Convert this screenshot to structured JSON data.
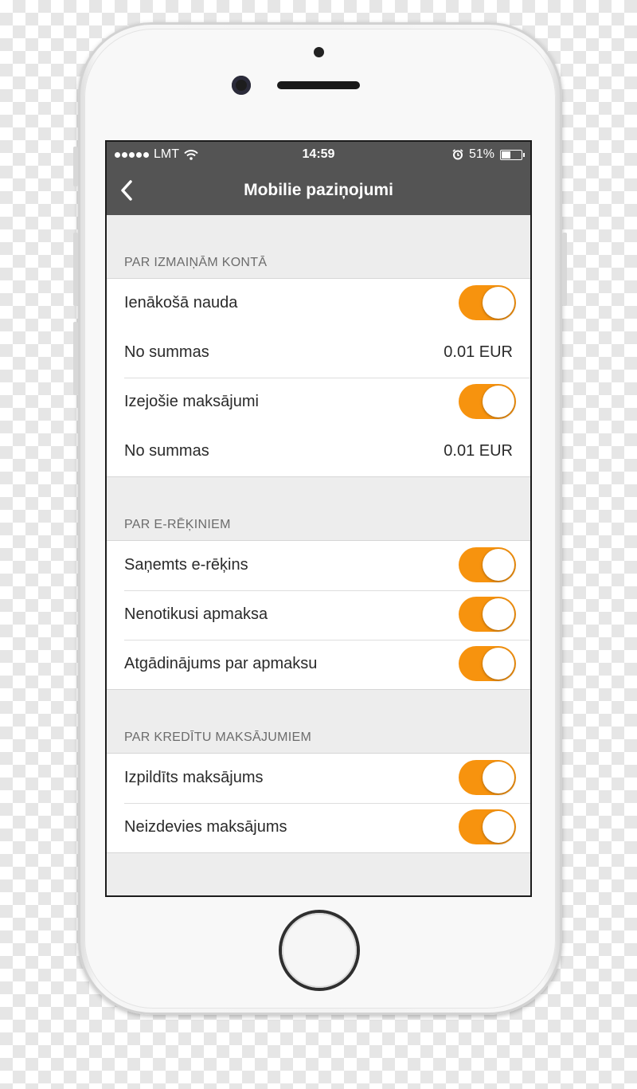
{
  "status_bar": {
    "carrier": "LMT",
    "time": "14:59",
    "battery_percent": "51%",
    "battery_level": 0.51
  },
  "nav": {
    "title": "Mobilie paziņojumi"
  },
  "sections": [
    {
      "header": "PAR IZMAIŅĀM KONTĀ",
      "rows": [
        {
          "label": "Ienākošā nauda",
          "toggle_on": true
        },
        {
          "label": "No summas",
          "value": "0.01  EUR"
        },
        {
          "label": "Izejošie maksājumi",
          "toggle_on": true
        },
        {
          "label": "No summas",
          "value": "0.01  EUR"
        }
      ]
    },
    {
      "header": "PAR E-RĒĶINIEM",
      "rows": [
        {
          "label": "Saņemts e-rēķins",
          "toggle_on": true
        },
        {
          "label": "Nenotikusi apmaksa",
          "toggle_on": true
        },
        {
          "label": "Atgādinājums par apmaksu",
          "toggle_on": true
        }
      ]
    },
    {
      "header": "PAR KREDĪTU MAKSĀJUMIEM",
      "rows": [
        {
          "label": "Izpildīts maksājums",
          "toggle_on": true
        },
        {
          "label": "Neizdevies maksājums",
          "toggle_on": true
        }
      ]
    }
  ],
  "colors": {
    "toggle_on": "#f7930e",
    "nav_background": "#545454",
    "screen_background": "#ededed"
  },
  "icons": {
    "back": "chevron-left-icon",
    "wifi": "wifi-icon",
    "alarm": "alarm-icon",
    "battery": "battery-icon"
  }
}
